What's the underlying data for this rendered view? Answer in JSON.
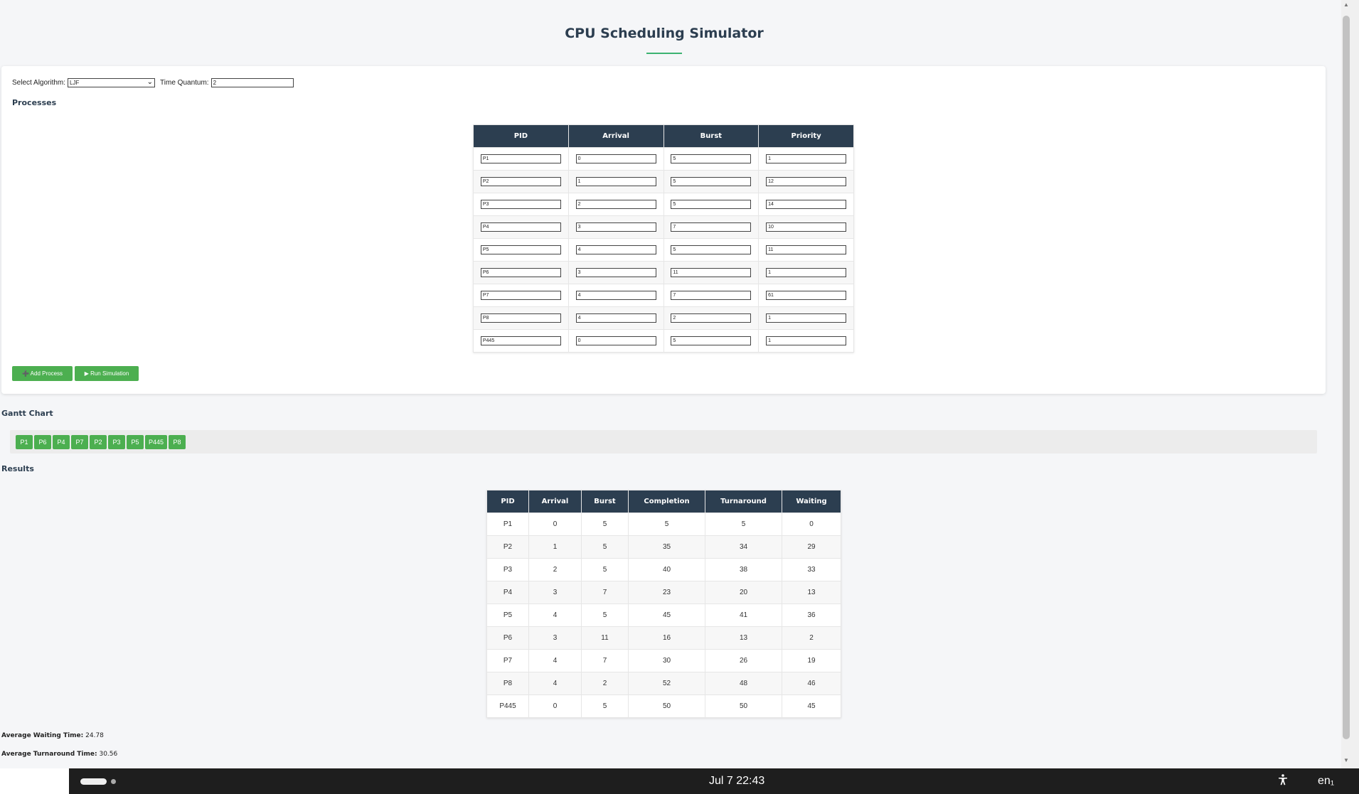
{
  "app": {
    "title": "CPU Scheduling Simulator"
  },
  "controls": {
    "algorithm_label": "Select Algorithm:",
    "algorithm_value": "LJF",
    "quantum_label": "Time Quantum:",
    "quantum_value": "2"
  },
  "processes": {
    "heading": "Processes",
    "columns": [
      "PID",
      "Arrival",
      "Burst",
      "Priority"
    ],
    "rows": [
      [
        "P1",
        "0",
        "5",
        "1"
      ],
      [
        "P2",
        "1",
        "5",
        "12"
      ],
      [
        "P3",
        "2",
        "5",
        "14"
      ],
      [
        "P4",
        "3",
        "7",
        "10"
      ],
      [
        "P5",
        "4",
        "5",
        "11"
      ],
      [
        "P6",
        "3",
        "11",
        "1"
      ],
      [
        "P7",
        "4",
        "7",
        "61"
      ],
      [
        "P8",
        "4",
        "2",
        "1"
      ],
      [
        "P445",
        "0",
        "5",
        "1"
      ]
    ],
    "add_button": "➕ Add Process",
    "run_button": "▶ Run Simulation"
  },
  "gantt": {
    "heading": "Gantt Chart",
    "blocks": [
      "P1",
      "P6",
      "P4",
      "P7",
      "P2",
      "P3",
      "P5",
      "P445",
      "P8"
    ],
    "block_color": "#4caf50"
  },
  "results": {
    "heading": "Results",
    "columns": [
      "PID",
      "Arrival",
      "Burst",
      "Completion",
      "Turnaround",
      "Waiting"
    ],
    "rows": [
      [
        "P1",
        "0",
        "5",
        "5",
        "5",
        "0"
      ],
      [
        "P2",
        "1",
        "5",
        "35",
        "34",
        "29"
      ],
      [
        "P3",
        "2",
        "5",
        "40",
        "38",
        "33"
      ],
      [
        "P4",
        "3",
        "7",
        "23",
        "20",
        "13"
      ],
      [
        "P5",
        "4",
        "5",
        "45",
        "41",
        "36"
      ],
      [
        "P6",
        "3",
        "11",
        "16",
        "13",
        "2"
      ],
      [
        "P7",
        "4",
        "7",
        "30",
        "26",
        "19"
      ],
      [
        "P8",
        "4",
        "2",
        "52",
        "48",
        "46"
      ],
      [
        "P445",
        "0",
        "5",
        "50",
        "50",
        "45"
      ]
    ],
    "avg_waiting_label": "Average Waiting Time:",
    "avg_waiting_value": "24.78",
    "avg_turnaround_label": "Average Turnaround Time:",
    "avg_turnaround_value": "30.56"
  },
  "taskbar": {
    "clock": "Jul 7  22:43",
    "language": "en₁",
    "accessibility_icon": "accessibility-icon"
  },
  "theme": {
    "header_bg": "#2c3e50",
    "accent": "#4caf50",
    "rule": "#3cb371"
  }
}
